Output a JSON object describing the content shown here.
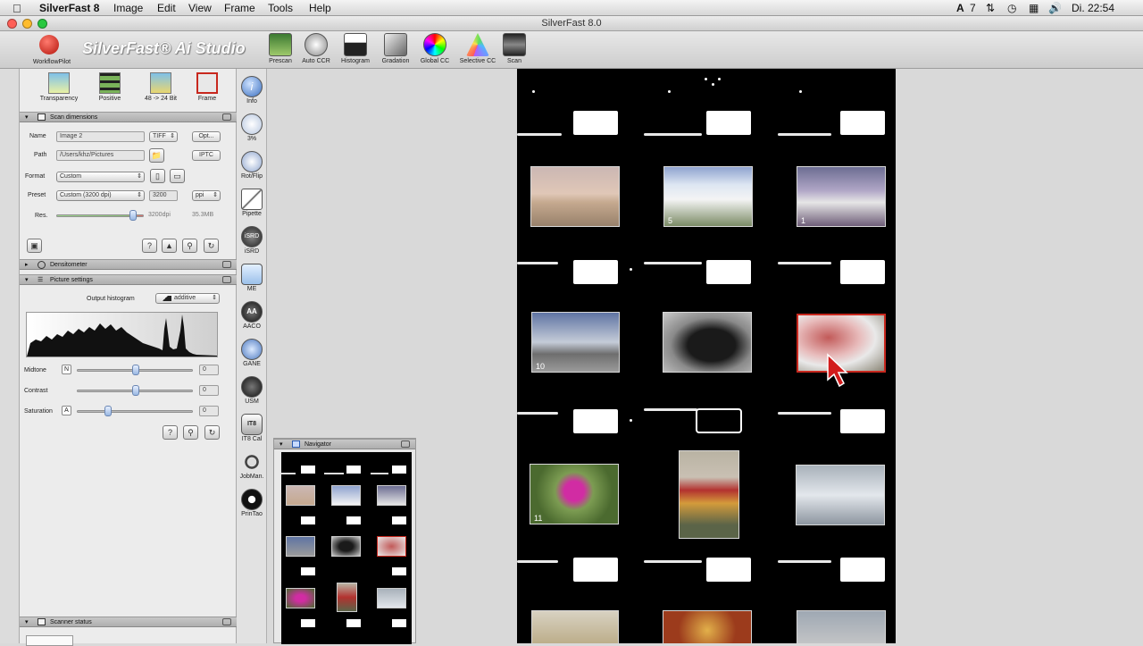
{
  "menubar": {
    "app_name": "SilverFast 8",
    "items": [
      "Image",
      "Edit",
      "View",
      "Frame",
      "Tools",
      "Help"
    ],
    "status_right": "Di. 22:54",
    "adobe_badge": "7"
  },
  "window": {
    "title": "SilverFast 8.0"
  },
  "brand": {
    "logo_text": "SilverFast® Ai Studio",
    "workflow_label": "WorkflowPilot"
  },
  "toolbar": {
    "buttons": [
      "Prescan",
      "Auto CCR",
      "Histogram",
      "Gradation",
      "Global CC",
      "Selective CC",
      "Scan"
    ]
  },
  "mode_buttons": [
    "Transparency",
    "Positive",
    "48 -> 24 Bit",
    "Frame"
  ],
  "scan_dimensions": {
    "header": "Scan dimensions",
    "name_label": "Name",
    "name_value": "Image 2",
    "file_type": "TIFF",
    "opt_label": "Opt...",
    "path_label": "Path",
    "path_value": "/Users/khz/Pictures",
    "iptc_label": "IPTC",
    "format_label": "Format",
    "format_value": "Custom",
    "preset_label": "Preset",
    "preset_value": "Custom (3200 dpi)",
    "resolution_value": "3200",
    "resolution_unit": "ppi",
    "res_label": "Res.",
    "res_dpi": "3200dpi",
    "file_size": "35.3MB"
  },
  "densitometer": {
    "header": "Densitometer"
  },
  "picture_settings": {
    "header": "Picture settings",
    "output_histogram_label": "Output histogram",
    "output_histogram_value": "additive",
    "midtone_label": "Midtone",
    "midtone_badge": "N",
    "midtone_value": "0",
    "contrast_label": "Contrast",
    "contrast_value": "0",
    "saturation_label": "Saturation",
    "saturation_badge": "A",
    "saturation_value": "0"
  },
  "scanner_status": {
    "header": "Scanner status"
  },
  "toolcol": {
    "items": [
      "Info",
      "3%",
      "Rot/Flip",
      "Pipette",
      "iSRD",
      "ME",
      "AACO",
      "GANE",
      "USM",
      "IT8 Cal",
      "JobMan.",
      "PrinTao"
    ],
    "isrd_text": "iSRD",
    "aa_text": "AA",
    "it8_text": "IT8"
  },
  "navigator": {
    "header": "Navigator"
  },
  "frames": {
    "numbers": [
      "5",
      "1",
      "10",
      "11"
    ]
  },
  "colors": {
    "accent_red": "#c8281e",
    "film_black": "#000000",
    "panel_bg": "#ececec"
  }
}
